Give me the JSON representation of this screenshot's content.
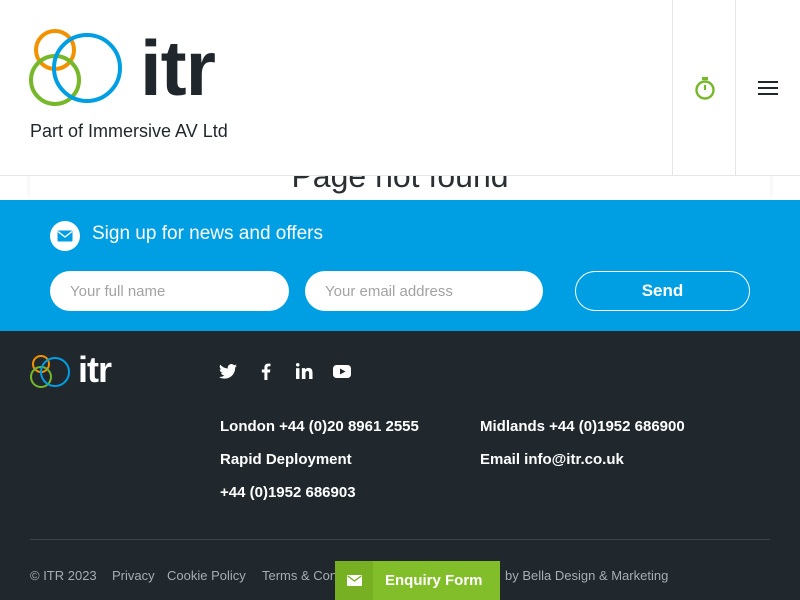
{
  "header": {
    "logo_text": "itr",
    "tagline": "Part of Immersive AV Ltd"
  },
  "main": {
    "title": "Page not found"
  },
  "signup": {
    "title": "Sign up for news and offers",
    "name_placeholder": "Your full name",
    "email_placeholder": "Your email address",
    "send_label": "Send"
  },
  "footer": {
    "logo_text": "itr",
    "social": [
      "twitter-icon",
      "facebook-icon",
      "linkedin-icon",
      "youtube-icon"
    ],
    "contacts": {
      "london": "London +44 (0)20 8961 2555",
      "midlands": "Midlands +44 (0)1952 686900",
      "rapid": "Rapid Deployment",
      "email": "Email info@itr.co.uk",
      "rapid_phone": "+44 (0)1952 686903"
    },
    "legal": {
      "copyright": "© ITR 2023",
      "privacy": "Privacy",
      "cookie": "Cookie Policy",
      "terms": "Terms & Conditions",
      "credit": "by Bella Design & Marketing"
    }
  },
  "enquiry": {
    "label": "Enquiry Form"
  },
  "colors": {
    "brand_blue": "#009fe3",
    "footer_bg": "#20282e",
    "enquiry_green": "#82bd2a",
    "logo_orange": "#f39200",
    "logo_green": "#76b82a",
    "logo_blue": "#009fe3"
  }
}
